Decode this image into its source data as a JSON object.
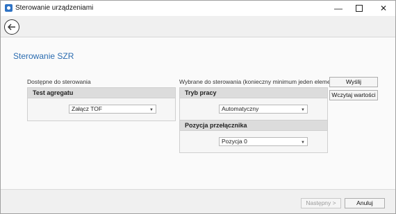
{
  "window": {
    "title": "Sterowanie urządzeniami"
  },
  "page": {
    "title": "Sterowanie SZR"
  },
  "left": {
    "section_label": "Dostępne do sterowania",
    "panel_title": "Test agregatu",
    "combo_value": "Załącz TOF"
  },
  "right": {
    "section_label": "Wybrane do sterowania (konieczny minimum jeden element)",
    "panels": [
      {
        "title": "Tryb pracy",
        "combo_value": "Automatyczny"
      },
      {
        "title": "Pozycja przełącznika",
        "combo_value": "Pozycja 0"
      }
    ]
  },
  "actions": {
    "send": "Wyślij",
    "load": "Wczytaj wartości"
  },
  "footer": {
    "next": "Następny >",
    "cancel": "Anuluj"
  },
  "icons": {
    "app": "app-icon",
    "back": "back-arrow-icon",
    "minimize": "minimize-icon",
    "maximize": "maximize-icon",
    "close": "close-icon",
    "dropdown": "chevron-down-icon"
  }
}
